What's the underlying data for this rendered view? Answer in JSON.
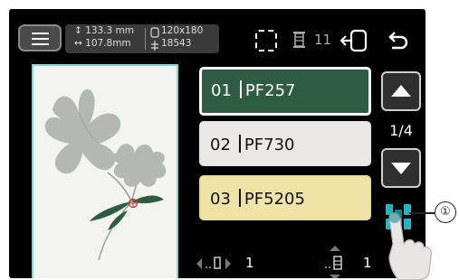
{
  "header": {
    "size_height": "↕ 133.3 mm",
    "size_width": "↔ 107.8mm",
    "hoop_size": "120x180",
    "stitch_count": "18543",
    "thread_count": "11"
  },
  "threads": [
    {
      "number": "01",
      "code": "PF257",
      "color": "#2e5c43"
    },
    {
      "number": "02",
      "code": "PF730",
      "color": "#ece8e6"
    },
    {
      "number": "03",
      "code": "PF5205",
      "color": "#efe4a6"
    }
  ],
  "pagination": {
    "indicator": "1/4"
  },
  "bottom": {
    "left_value": "1",
    "right_value": "1"
  },
  "callout": {
    "label": "①"
  },
  "colors": {
    "accent": "#7fd8db",
    "grouping_icon": "#26b5c0",
    "background": "#000000"
  }
}
